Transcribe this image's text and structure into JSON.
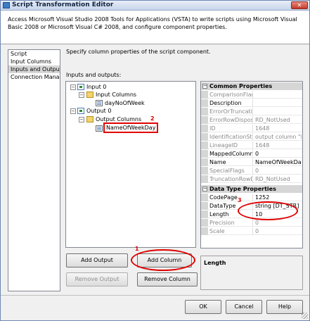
{
  "window": {
    "title": "Script Transformation Editor",
    "close_label": "✕"
  },
  "header": {
    "text": "Access Microsoft Visual Studio 2008 Tools for Applications (VSTA) to write scripts using Microsoft Visual Basic 2008 or Microsoft Visual C# 2008, and configure component properties."
  },
  "nav": {
    "items": [
      {
        "label": "Script",
        "selected": false
      },
      {
        "label": "Input Columns",
        "selected": false
      },
      {
        "label": "Inputs and Outputs",
        "selected": true
      },
      {
        "label": "Connection Managers",
        "selected": false
      }
    ]
  },
  "main": {
    "description": "Specify column properties of the script component.",
    "io_label": "Inputs and outputs:"
  },
  "tree": {
    "input": {
      "label": "Input 0",
      "expander": "−"
    },
    "input_columns": {
      "label": "Input Columns",
      "expander": "−"
    },
    "input_col": {
      "label": "dayNoOfWeek"
    },
    "output": {
      "label": "Output 0",
      "expander": "−"
    },
    "output_columns": {
      "label": "Output Columns",
      "expander": "−"
    },
    "output_col": {
      "label": "NameOfWeekDay"
    }
  },
  "annotations": {
    "n1": "1",
    "n2": "2",
    "n3": "3"
  },
  "props": {
    "common_title": "Common Properties",
    "datatype_title": "Data Type Properties",
    "cat_expander": "−",
    "common": [
      {
        "name": "ComparisonFlags",
        "value": "",
        "readonly": true
      },
      {
        "name": "Description",
        "value": "",
        "readonly": false
      },
      {
        "name": "ErrorOrTruncation",
        "value": "",
        "readonly": true
      },
      {
        "name": "ErrorRowDisposition",
        "value": "RD_NotUsed",
        "readonly": true
      },
      {
        "name": "ID",
        "value": "1648",
        "readonly": true
      },
      {
        "name": "IdentificationString",
        "value": "output column \"NameOfWeekDay\"",
        "readonly": true
      },
      {
        "name": "LineageID",
        "value": "1648",
        "readonly": true
      },
      {
        "name": "MappedColumnID",
        "value": "0",
        "readonly": false
      },
      {
        "name": "Name",
        "value": "NameOfWeekDay",
        "readonly": false
      },
      {
        "name": "SpecialFlags",
        "value": "0",
        "readonly": true
      },
      {
        "name": "TruncationRowDisposition",
        "value": "RD_NotUsed",
        "readonly": true
      }
    ],
    "datatype": [
      {
        "name": "CodePage",
        "value": "1252",
        "readonly": false
      },
      {
        "name": "DataType",
        "value": "string [DT_STR]",
        "readonly": false
      },
      {
        "name": "Length",
        "value": "10",
        "readonly": false
      },
      {
        "name": "Precision",
        "value": "0",
        "readonly": true
      },
      {
        "name": "Scale",
        "value": "0",
        "readonly": true
      }
    ],
    "desc_title": "Length"
  },
  "buttons": {
    "add_output": "Add Output",
    "add_column": "Add Column",
    "remove_output": "Remove Output",
    "remove_column": "Remove Column",
    "ok": "OK",
    "cancel": "Cancel",
    "help": "Help"
  },
  "colors": {
    "annotation_red": "#e00000",
    "selection_gray": "#d6d6d6"
  }
}
